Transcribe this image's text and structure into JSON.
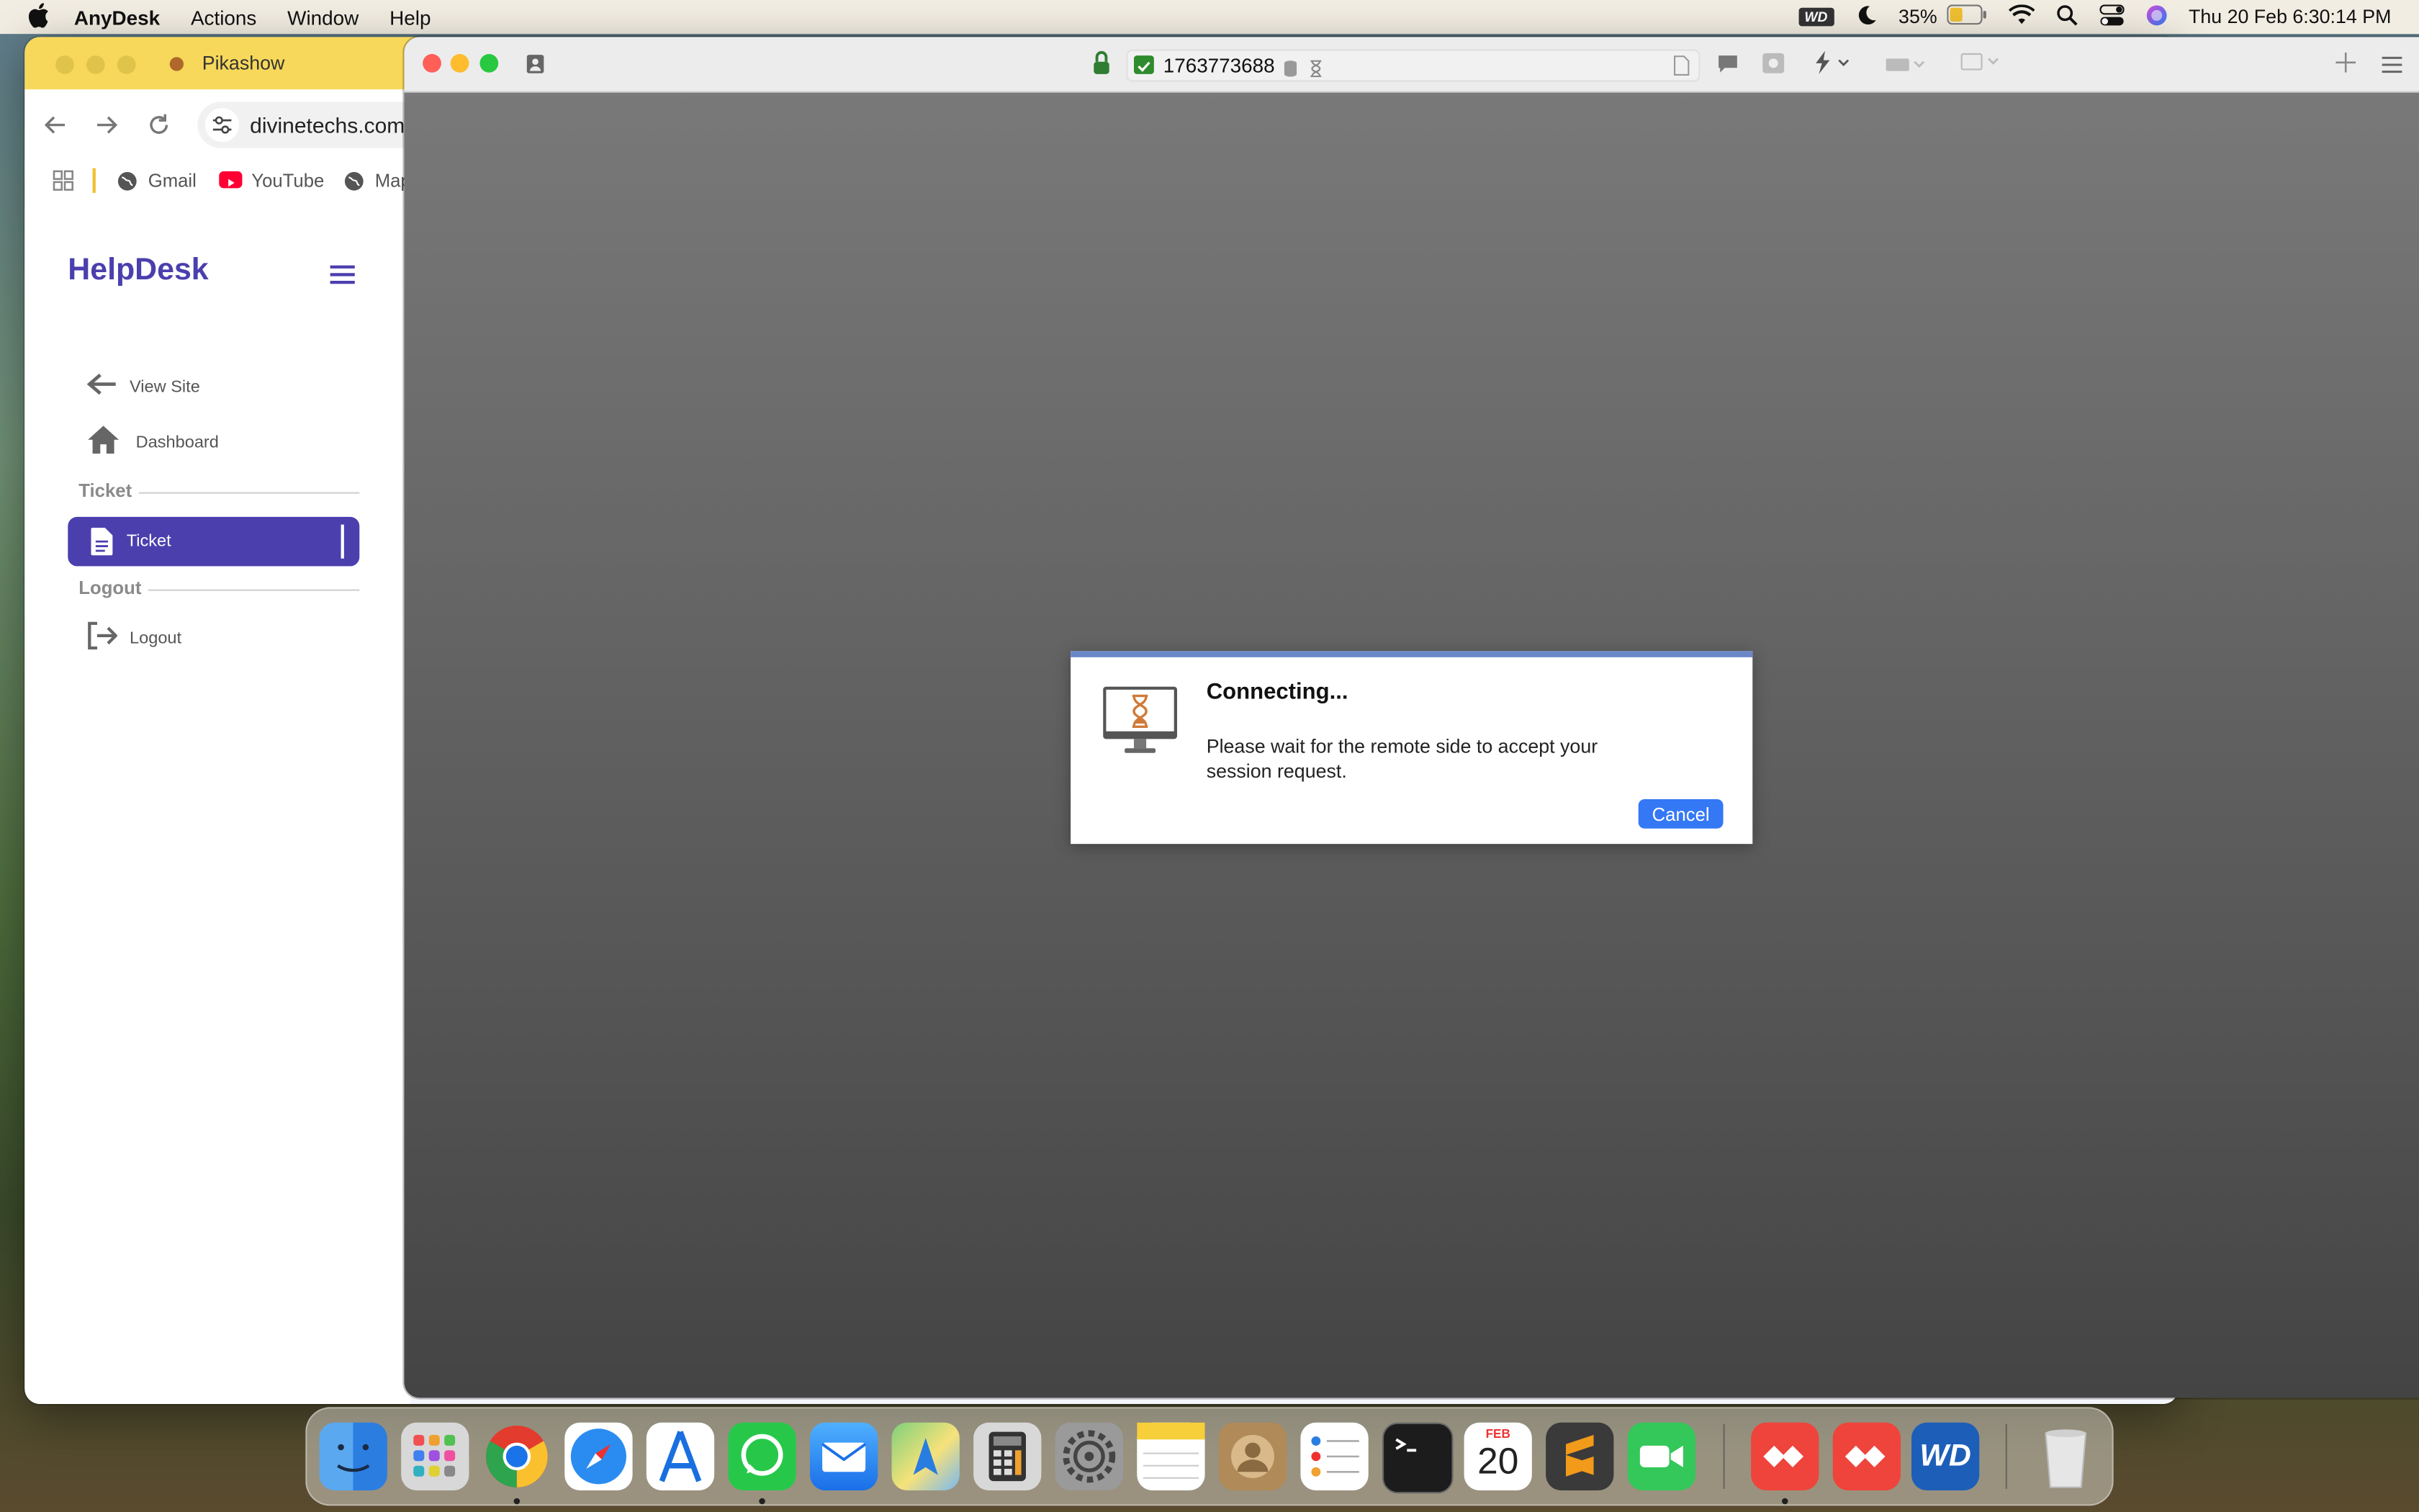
{
  "menubar": {
    "app_name": "AnyDesk",
    "items": [
      "Actions",
      "Window",
      "Help"
    ],
    "battery": "35%",
    "datetime": "Thu 20 Feb  6:30:14 PM",
    "wd_label": "WD"
  },
  "browser": {
    "tab_title": "Pikashow",
    "url": "divinetechs.com",
    "bookmarks": [
      "Gmail",
      "YouTube",
      "Maps"
    ]
  },
  "sidebar": {
    "logo": "HelpDesk",
    "view_site": "View Site",
    "dashboard": "Dashboard",
    "section_ticket": "Ticket",
    "ticket": "Ticket",
    "section_logout": "Logout",
    "logout": "Logout"
  },
  "anydesk": {
    "address": "1763773688"
  },
  "dialog": {
    "title": "Connecting...",
    "message": "Please wait for the remote side to accept your session request.",
    "cancel": "Cancel"
  },
  "dock": {
    "calendar_month": "FEB",
    "calendar_day": "20",
    "apps": [
      "finder",
      "launchpad",
      "chrome",
      "safari",
      "xcode",
      "whatsapp",
      "mail",
      "maps",
      "calculator",
      "system-settings",
      "notes",
      "contacts",
      "reminders",
      "terminal",
      "calendar",
      "sublime-text",
      "facetime",
      "anydesk",
      "anydesk",
      "wd-discovery",
      "trash"
    ],
    "colors": {
      "accent": "#4b3fae",
      "button": "#3478f6",
      "anydesk": "#ef443b"
    }
  }
}
